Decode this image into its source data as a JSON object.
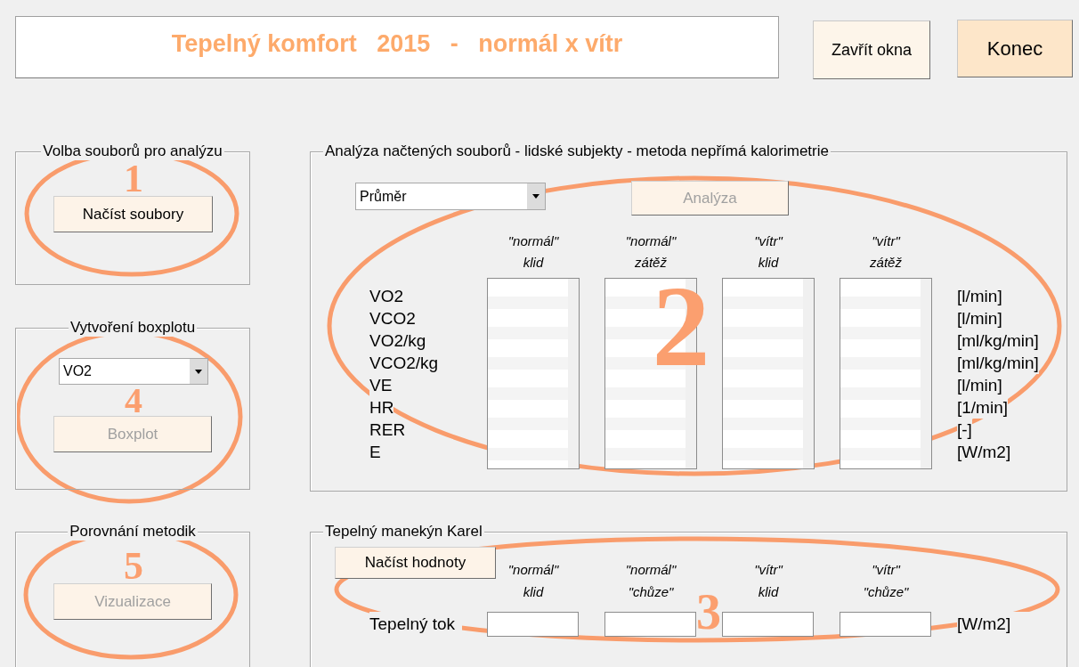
{
  "title": "Tepelný komfort   2015   -   normál x vítr",
  "header_buttons": [
    {
      "label": "Zavřít okna",
      "kind": "small"
    },
    {
      "label": "Konec",
      "kind": "large"
    }
  ],
  "file_panel": {
    "title": "Volba souborů pro analýzu",
    "button": {
      "label": "Načíst soubory",
      "disabled": false
    }
  },
  "boxplot_panel": {
    "title": "Vytvoření boxplotu",
    "dropdown": {
      "value": "VO2"
    },
    "button": {
      "label": "Boxplot",
      "disabled": true
    }
  },
  "compare_panel": {
    "title": "Porovnání metodik",
    "button": {
      "label": "Vizualizace",
      "disabled": true
    }
  },
  "analysis_panel": {
    "title": "Analýza načtených souborů - lidské subjekty - metoda nepřímá kalorimetrie",
    "dropdown": {
      "value": "Průměr"
    },
    "button": {
      "label": "Analýza",
      "disabled": true
    },
    "columns": [
      {
        "line_1": "\"normál\"",
        "line_2": "klid"
      },
      {
        "line_1": "\"normál\"",
        "line_2": "zátěž"
      },
      {
        "line_1": "\"vítr\"",
        "line_2": "klid"
      },
      {
        "line_1": "\"vítr\"",
        "line_2": "zátěž"
      }
    ],
    "rows": [
      {
        "label": "VO2",
        "unit": "[l/min]"
      },
      {
        "label": "VCO2",
        "unit": "[l/min]"
      },
      {
        "label": "VO2/kg",
        "unit": "[ml/kg/min]"
      },
      {
        "label": "VCO2/kg",
        "unit": "[ml/kg/min]"
      },
      {
        "label": "VE",
        "unit": "[l/min]"
      },
      {
        "label": "HR",
        "unit": "[1/min]"
      },
      {
        "label": "RER",
        "unit": "[-]"
      },
      {
        "label": "E",
        "unit": "[W/m2]"
      }
    ]
  },
  "manikin_panel": {
    "title": "Tepelný manekýn Karel",
    "button": {
      "label": "Načíst hodnoty",
      "disabled": false
    },
    "columns": [
      {
        "line_1": "\"normál\"",
        "line_2": "klid"
      },
      {
        "line_1": "\"normál\"",
        "line_2": "\"chůze\""
      },
      {
        "line_1": "\"vítr\"",
        "line_2": "klid"
      },
      {
        "line_1": "\"vítr\"",
        "line_2": "\"chůze\""
      }
    ],
    "row_label": "Tepelný tok",
    "unit": "[W/m2]"
  },
  "annotations": [
    {
      "number": "1"
    },
    {
      "number": "2"
    },
    {
      "number": "4"
    },
    {
      "number": "5"
    },
    {
      "number": "3"
    }
  ]
}
